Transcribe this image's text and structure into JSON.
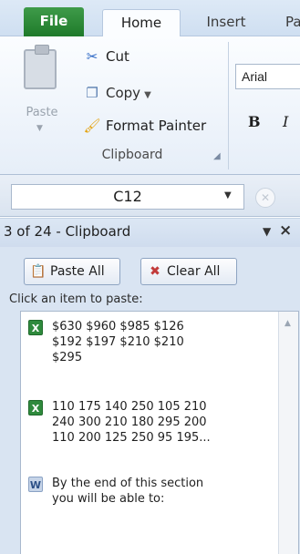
{
  "ribbon": {
    "tabs": [
      "File",
      "Home",
      "Insert",
      "Pa"
    ],
    "active_tab": "Home",
    "clipboard_group": {
      "paste_label": "Paste",
      "cut_label": "Cut",
      "copy_label": "Copy",
      "format_painter_label": "Format Painter",
      "group_label": "Clipboard"
    },
    "font_group": {
      "font_name": "Arial",
      "bold_label": "B",
      "italic_label": "I"
    }
  },
  "formula_bar": {
    "name_box_value": "C12"
  },
  "clipboard_pane": {
    "title": "3 of 24 - Clipboard",
    "paste_all_label": "Paste All",
    "clear_all_label": "Clear All",
    "instruction": "Click an item to paste:",
    "items": [
      {
        "icon": "excel-icon",
        "text": "$630 $960 $985 $126\n$192 $197 $210 $210\n$295"
      },
      {
        "icon": "excel-icon",
        "text": "110 175 140 250 105 210\n240 300 210 180 295 200\n110 200 125 250 95 195..."
      },
      {
        "icon": "word-icon",
        "text": "By the end of this section\nyou will be able to:"
      }
    ]
  },
  "colors": {
    "file_tab": "#1f7a2a",
    "ribbon_bg": "#e6eef8",
    "pane_bg": "#d9e4f2"
  }
}
